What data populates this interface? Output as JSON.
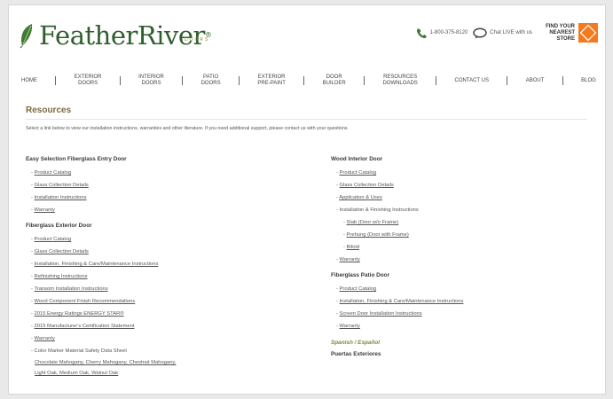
{
  "brand": {
    "name_prefix": "Feather",
    "name_suffix": "River",
    "tagline": "DOORS",
    "trademark": "®"
  },
  "utility": {
    "phone": "1-800-375-8120",
    "chat": "Chat LIVE with us",
    "store_line1": "FIND YOUR",
    "store_line2": "NEAREST",
    "store_line3": "STORE"
  },
  "nav": [
    {
      "label": "HOME"
    },
    {
      "label": "EXTERIOR\nDOORS"
    },
    {
      "label": "INTERIOR\nDOORS"
    },
    {
      "label": "PATIO\nDOORS"
    },
    {
      "label": "EXTERIOR\nPRE-PAINT"
    },
    {
      "label": "DOOR\nBUILDER"
    },
    {
      "label": "RESOURCES\nDOWNLOADS"
    },
    {
      "label": "CONTACT US"
    },
    {
      "label": "ABOUT"
    },
    {
      "label": "BLOG"
    }
  ],
  "page": {
    "title": "Resources",
    "intro": "Select a link below to view our installation instructions, warranties and other literature. If you need additional support, please contact us with your questions."
  },
  "left": {
    "group1_title": "Easy Selection Fiberglass Entry Door",
    "group1_links": [
      "Product Catalog",
      "Glass Collection Details",
      "Installation Instructions",
      "Warranty"
    ],
    "group2_title": "Fiberglass Exterior Door",
    "group2_links": [
      "Product Catalog",
      "Glass Collection Details",
      "Installation, Finishing & Care/Maintenance Instructions",
      "Refinishing Instructions",
      "Transom Installation Instructions",
      "Wood Component Finish Recommendations",
      "2015 Energy Ratings ENERGY STAR®",
      "2015 Manufacturer's Certification Statement",
      "Warranty"
    ],
    "msds_label": "Color Marker Material Safety Data Sheet",
    "msds_line1": "Chocolate Mahogany, Cherry Mahogany, Chestnut Mahogany,",
    "msds_line2": "Light Oak, Medium Oak, Walnut Oak"
  },
  "right": {
    "group1_title": "Wood Interior Door",
    "group1_links": [
      "Product Catalog",
      "Glass Collection Details",
      "Application & Uses"
    ],
    "install_label": "Installation & Finishing Instructions",
    "install_sub": [
      "Slab (Door w/o Frame)",
      "Prehung (Door with Frame)",
      "Bifold"
    ],
    "warranty": "Warranty",
    "group2_title": "Fiberglass Patio Door",
    "group2_links": [
      "Product Catalog",
      "Installation, Finishing & Care/Maintenance Instructions",
      "Screen Door Installation Instructions",
      "Warranty"
    ],
    "spanish_label": "Spanish / Español",
    "spanish_group_title": "Puertas Exteriores"
  },
  "colors": {
    "brand_green": "#2f5e2e",
    "accent_olive": "#7a6a44",
    "home_depot_orange": "#f47a20"
  }
}
